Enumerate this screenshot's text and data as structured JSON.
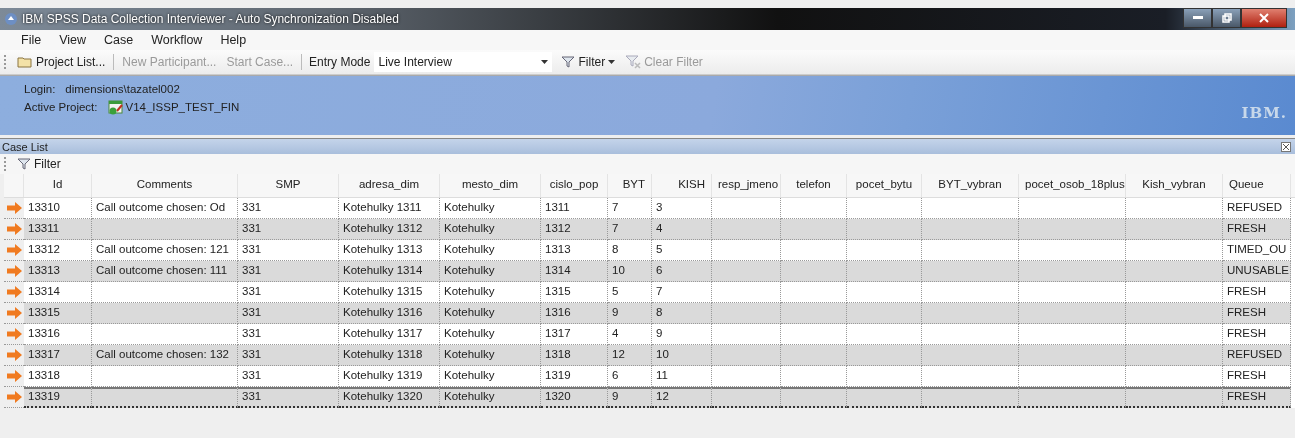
{
  "window": {
    "title": "IBM SPSS Data Collection Interviewer - Auto Synchronization Disabled"
  },
  "menu": [
    "File",
    "View",
    "Case",
    "Workflow",
    "Help"
  ],
  "toolbar": {
    "project_list": "Project List...",
    "new_participant": {
      "label": "New Participant...",
      "disabled": true
    },
    "start_case": {
      "label": "Start Case...",
      "disabled": true
    },
    "entry_mode_label": "Entry Mode",
    "entry_mode": "Live Interview",
    "filter": "Filter",
    "clear_filter": {
      "label": "Clear Filter",
      "disabled": true
    }
  },
  "header": {
    "login_label": "Login:",
    "login": "dimensions\\tazatel002",
    "project_label": "Active Project:",
    "project": "V14_ISSP_TEST_FIN",
    "logo": "IBM."
  },
  "case_list": {
    "title": "Case List",
    "filter": "Filter",
    "columns": [
      "Id",
      "Comments",
      "SMP",
      "adresa_dim",
      "mesto_dim",
      "cislo_pop",
      "BYT",
      "KISH",
      "resp_jmeno",
      "telefon",
      "pocet_bytu",
      "BYT_vybran",
      "pocet_osob_18plus",
      "Kish_vybran",
      "Queue"
    ],
    "rows": [
      {
        "selected": false,
        "cells": [
          "13310",
          "Call outcome chosen: Od",
          "331",
          "Kotehulky 1311",
          "Kotehulky",
          "1311",
          "7",
          "3",
          "",
          "",
          "",
          "",
          "",
          "",
          "REFUSED"
        ]
      },
      {
        "selected": false,
        "cells": [
          "13311",
          "",
          "331",
          "Kotehulky 1312",
          "Kotehulky",
          "1312",
          "7",
          "4",
          "",
          "",
          "",
          "",
          "",
          "",
          "FRESH"
        ]
      },
      {
        "selected": false,
        "cells": [
          "13312",
          "Call outcome chosen: 121",
          "331",
          "Kotehulky 1313",
          "Kotehulky",
          "1313",
          "8",
          "5",
          "",
          "",
          "",
          "",
          "",
          "",
          "TIMED_OU"
        ]
      },
      {
        "selected": false,
        "cells": [
          "13313",
          "Call outcome chosen: 111",
          "331",
          "Kotehulky 1314",
          "Kotehulky",
          "1314",
          "10",
          "6",
          "",
          "",
          "",
          "",
          "",
          "",
          "UNUSABLE"
        ]
      },
      {
        "selected": false,
        "cells": [
          "13314",
          "",
          "331",
          "Kotehulky 1315",
          "Kotehulky",
          "1315",
          "5",
          "7",
          "",
          "",
          "",
          "",
          "",
          "",
          "FRESH"
        ]
      },
      {
        "selected": false,
        "cells": [
          "13315",
          "",
          "331",
          "Kotehulky 1316",
          "Kotehulky",
          "1316",
          "9",
          "8",
          "",
          "",
          "",
          "",
          "",
          "",
          "FRESH"
        ]
      },
      {
        "selected": false,
        "cells": [
          "13316",
          "",
          "331",
          "Kotehulky 1317",
          "Kotehulky",
          "1317",
          "4",
          "9",
          "",
          "",
          "",
          "",
          "",
          "",
          "FRESH"
        ]
      },
      {
        "selected": false,
        "cells": [
          "13317",
          "Call outcome chosen: 132",
          "331",
          "Kotehulky 1318",
          "Kotehulky",
          "1318",
          "12",
          "10",
          "",
          "",
          "",
          "",
          "",
          "",
          "REFUSED"
        ]
      },
      {
        "selected": false,
        "cells": [
          "13318",
          "",
          "331",
          "Kotehulky 1319",
          "Kotehulky",
          "1319",
          "6",
          "11",
          "",
          "",
          "",
          "",
          "",
          "",
          "FRESH"
        ]
      },
      {
        "selected": true,
        "cells": [
          "13319",
          "",
          "331",
          "Kotehulky 1320",
          "Kotehulky",
          "1320",
          "9",
          "12",
          "",
          "",
          "",
          "",
          "",
          "",
          "FRESH"
        ]
      }
    ]
  }
}
